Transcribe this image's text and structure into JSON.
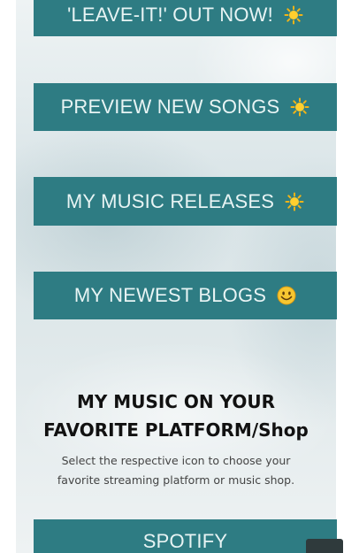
{
  "menu_buttons": [
    {
      "label": "'LEAVE-IT!' OUT NOW!",
      "icon": "sun-icon"
    },
    {
      "label": "PREVIEW NEW SONGS",
      "icon": "sun-icon"
    },
    {
      "label": "MY MUSIC RELEASES",
      "icon": "sun-icon"
    },
    {
      "label": "MY NEWEST BLOGS",
      "icon": "smiley-icon"
    }
  ],
  "platforms": {
    "heading_line1": "MY MUSIC ON YOUR",
    "heading_line2": "FAVORITE PLATFORM/Shop",
    "subtitle_line1": "Select the respective icon to choose your",
    "subtitle_line2": "favorite streaming platform or music shop.",
    "spotify_label": "SPOTIFY"
  },
  "colors": {
    "button_bg": "#2e7c83",
    "button_text": "#e8f4f4",
    "heading_text": "#111111",
    "subtitle_text": "#444444",
    "scroll_button": "#2f3a3c"
  }
}
